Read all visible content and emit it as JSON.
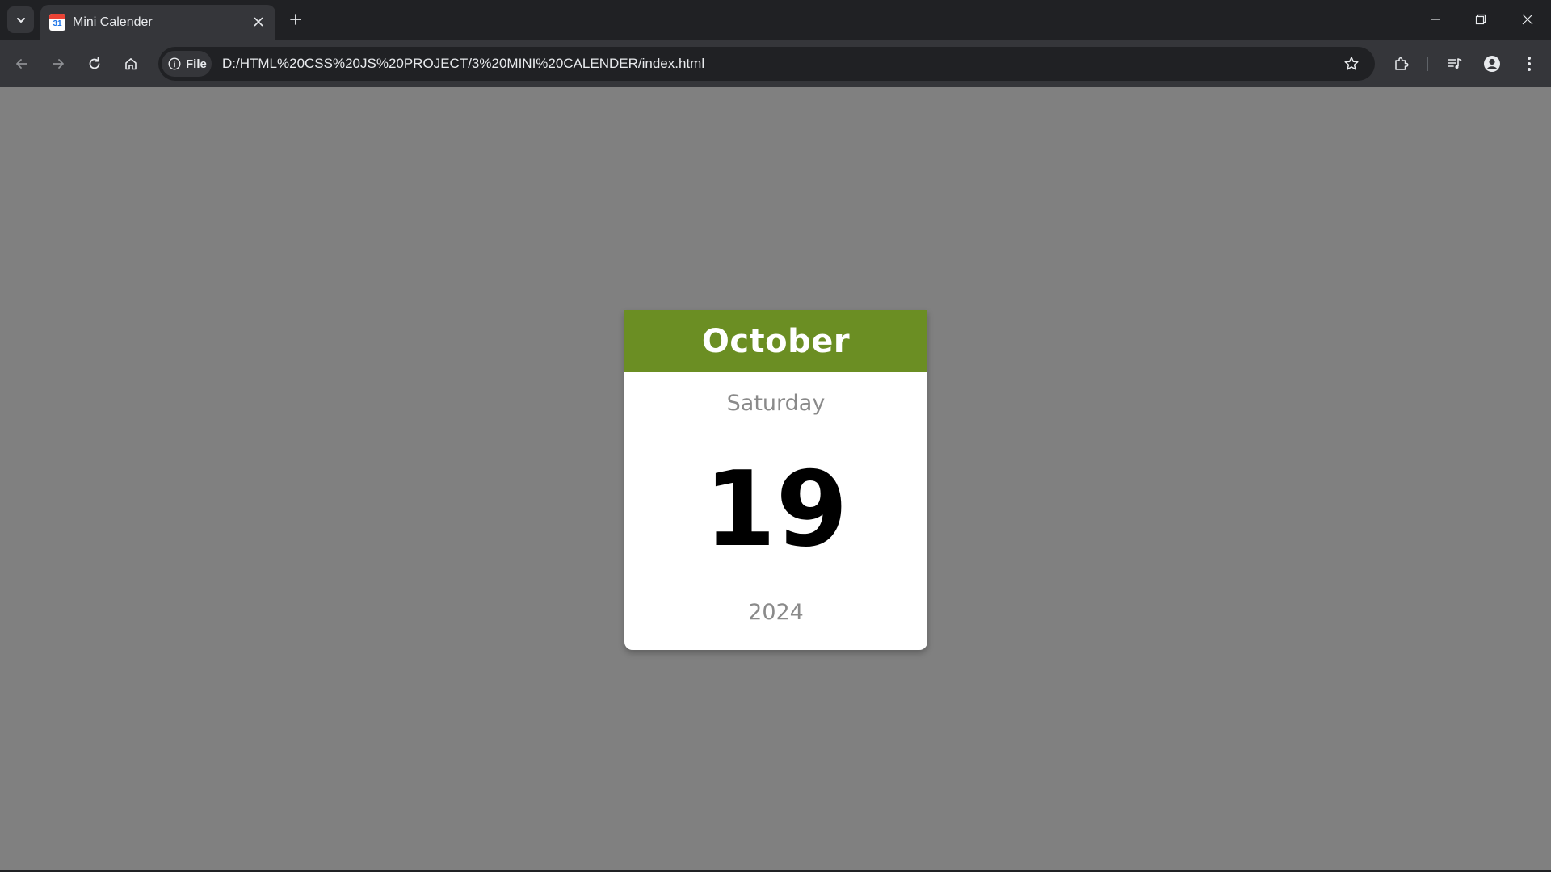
{
  "browser": {
    "tab": {
      "title": "Mini Calender",
      "favicon_number": "31",
      "favicon_icon": "calendar-favicon"
    },
    "address_bar": {
      "security_chip_label": "File",
      "url": "D:/HTML%20CSS%20JS%20PROJECT/3%20MINI%20CALENDER/index.html"
    },
    "icons": {
      "tab_search": "chevron-down-icon",
      "tab_close": "close-icon",
      "new_tab": "plus-icon",
      "minimize": "minimize-icon",
      "restore": "restore-icon",
      "close_window": "close-icon",
      "back": "arrow-left-icon",
      "forward": "arrow-right-icon",
      "reload": "reload-icon",
      "home": "home-icon",
      "info": "info-icon",
      "bookmark": "star-icon",
      "extensions": "puzzle-icon",
      "media": "media-queue-icon",
      "profile": "account-icon",
      "menu": "kebab-menu-icon"
    }
  },
  "calendar": {
    "month": "October",
    "day_name": "Saturday",
    "date": "19",
    "year": "2024"
  },
  "colors": {
    "page_background": "#808080",
    "month_bar": "#6b8e23",
    "card_background": "#ffffff",
    "muted_text": "#8a8a8a",
    "date_text": "#000000"
  }
}
